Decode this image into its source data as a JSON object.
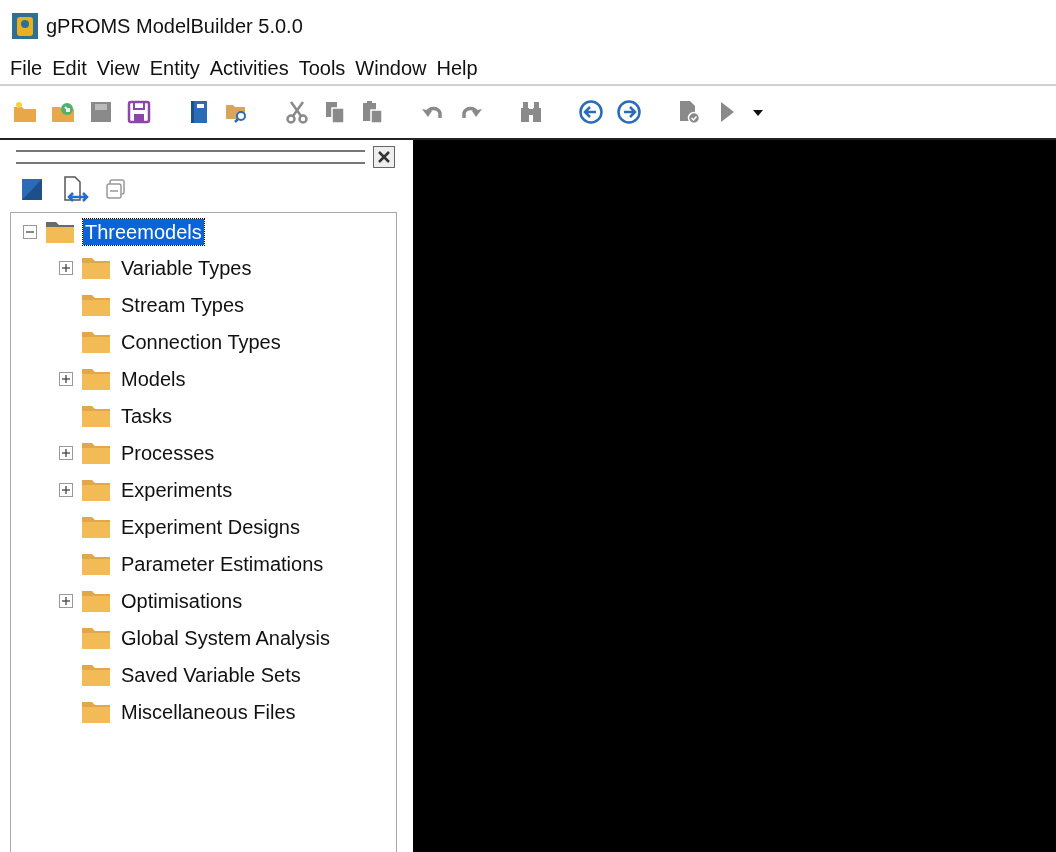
{
  "window": {
    "title": "gPROMS ModelBuilder 5.0.0"
  },
  "menu": [
    "File",
    "Edit",
    "View",
    "Entity",
    "Activities",
    "Tools",
    "Window",
    "Help"
  ],
  "toolbar": [
    {
      "kind": "new",
      "disabled": false
    },
    {
      "kind": "open",
      "disabled": false
    },
    {
      "kind": "save",
      "disabled": true
    },
    {
      "kind": "saveas",
      "disabled": false
    },
    {
      "kind": "separator"
    },
    {
      "kind": "book",
      "disabled": false
    },
    {
      "kind": "browse",
      "disabled": false
    },
    {
      "kind": "separator"
    },
    {
      "kind": "cut",
      "disabled": true
    },
    {
      "kind": "copy",
      "disabled": true
    },
    {
      "kind": "paste",
      "disabled": true
    },
    {
      "kind": "separator"
    },
    {
      "kind": "undo",
      "disabled": true
    },
    {
      "kind": "redo",
      "disabled": true
    },
    {
      "kind": "separator"
    },
    {
      "kind": "find",
      "disabled": true
    },
    {
      "kind": "separator"
    },
    {
      "kind": "back",
      "disabled": false
    },
    {
      "kind": "forward",
      "disabled": false
    },
    {
      "kind": "separator"
    },
    {
      "kind": "report",
      "disabled": true
    },
    {
      "kind": "run",
      "disabled": true
    },
    {
      "kind": "dropdown",
      "disabled": false
    }
  ],
  "tree": {
    "label": "Threemodels",
    "expanded": true,
    "selected": true,
    "children": [
      {
        "label": "Variable Types",
        "expandable": true,
        "selected": false
      },
      {
        "label": "Stream Types",
        "expandable": false,
        "selected": false
      },
      {
        "label": "Connection Types",
        "expandable": false,
        "selected": false
      },
      {
        "label": "Models",
        "expandable": true,
        "selected": false
      },
      {
        "label": "Tasks",
        "expandable": false,
        "selected": false
      },
      {
        "label": "Processes",
        "expandable": true,
        "selected": false
      },
      {
        "label": "Experiments",
        "expandable": true,
        "selected": false
      },
      {
        "label": "Experiment Designs",
        "expandable": false,
        "selected": false
      },
      {
        "label": "Parameter Estimations",
        "expandable": false,
        "selected": false
      },
      {
        "label": "Optimisations",
        "expandable": true,
        "selected": false
      },
      {
        "label": "Global System Analysis",
        "expandable": false,
        "selected": false
      },
      {
        "label": "Saved Variable Sets",
        "expandable": false,
        "selected": false
      },
      {
        "label": "Miscellaneous Files",
        "expandable": false,
        "selected": false
      }
    ]
  }
}
